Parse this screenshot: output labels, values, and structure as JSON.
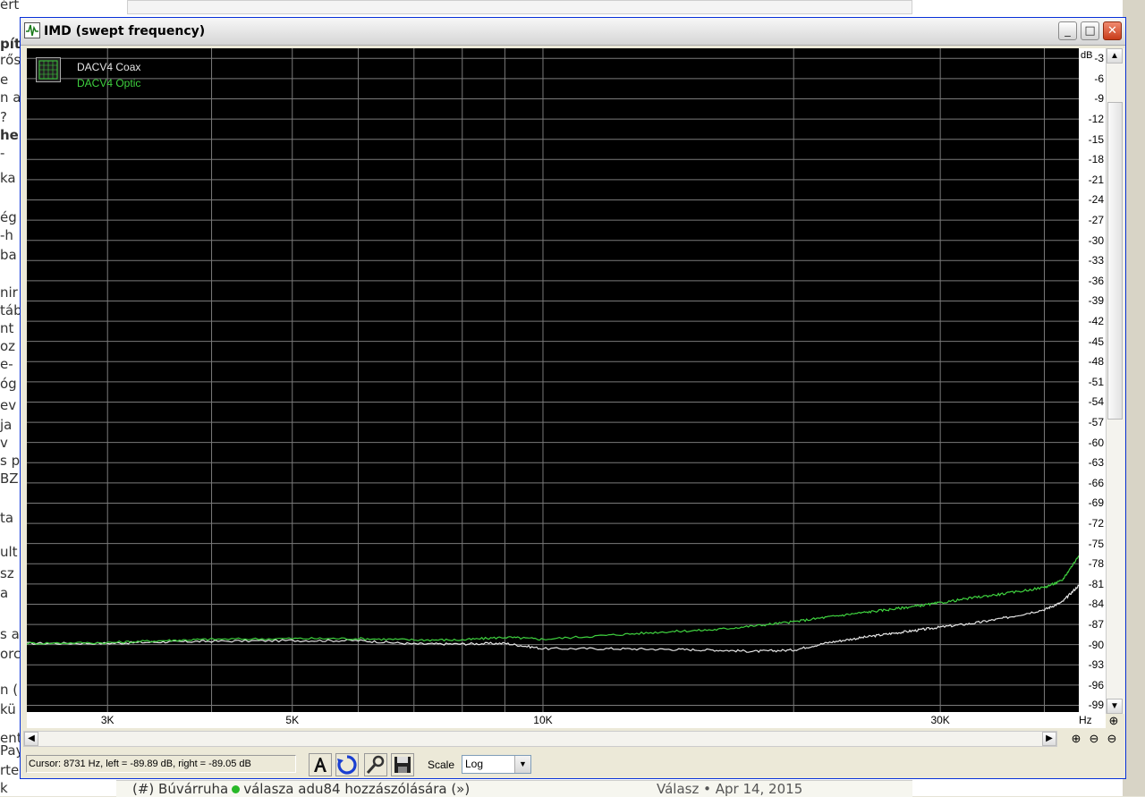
{
  "background_page": {
    "fragments": [
      {
        "text": "értek hogyanok",
        "bold": false
      },
      {
        "text": "pít",
        "bold": true
      },
      {
        "text": "rős",
        "bold": false
      },
      {
        "text": "e",
        "bold": false
      },
      {
        "text": "n al",
        "bold": false
      },
      {
        "text": "?",
        "bold": false
      },
      {
        "text": "he",
        "bold": true
      },
      {
        "text": "-",
        "bold": false
      },
      {
        "text": "ka",
        "bold": false
      },
      {
        "text": "ég",
        "bold": false
      },
      {
        "text": "-h",
        "bold": false
      },
      {
        "text": "ba",
        "bold": false
      },
      {
        "text": "nir",
        "bold": false
      },
      {
        "text": "táb",
        "bold": false
      },
      {
        "text": "nt",
        "bold": false
      },
      {
        "text": "oz",
        "bold": false
      },
      {
        "text": "e-",
        "bold": false
      },
      {
        "text": "óg",
        "bold": false
      },
      {
        "text": "ev",
        "bold": false
      },
      {
        "text": "ja",
        "bold": false
      },
      {
        "text": "v",
        "bold": false
      },
      {
        "text": "s p",
        "bold": false
      },
      {
        "text": "BZ",
        "bold": false
      },
      {
        "text": "ta",
        "bold": false
      },
      {
        "text": "ult",
        "bold": false
      },
      {
        "text": "sz",
        "bold": false
      },
      {
        "text": "a",
        "bold": false
      },
      {
        "text": "s a",
        "bold": false
      },
      {
        "text": "orc",
        "bold": false
      },
      {
        "text": "n (",
        "bold": false
      },
      {
        "text": "kü",
        "bold": false
      },
      {
        "text": "Pay",
        "bold": false
      },
      {
        "text": "rte",
        "bold": false
      },
      {
        "text": "k",
        "bold": false
      },
      {
        "text": "entes táp",
        "bold": false
      }
    ],
    "bottom_link": "(#) Búvárruha",
    "bottom_link_rest": "válasza adu84 hozzászólására (»)",
    "bottom_meta": "Válasz • Apr 14, 2015"
  },
  "window": {
    "title": "IMD (swept frequency)",
    "buttons": {
      "minimize": "_",
      "maximize": "□",
      "close": "✕"
    }
  },
  "chart_data": {
    "type": "line",
    "title": "",
    "xlabel": "Hz",
    "ylabel": "dB",
    "x_scale": "log",
    "xlim": [
      2400,
      44000
    ],
    "ylim": [
      -100,
      -1.5
    ],
    "x_ticks": [
      3000,
      5000,
      10000,
      30000
    ],
    "x_tick_labels": [
      "3K",
      "5K",
      "10K",
      "30K"
    ],
    "y_ticks": [
      -3,
      -6,
      -9,
      -12,
      -15,
      -18,
      -21,
      -24,
      -27,
      -30,
      -33,
      -36,
      -39,
      -42,
      -45,
      -48,
      -51,
      -54,
      -57,
      -60,
      -63,
      -66,
      -69,
      -72,
      -75,
      -78,
      -81,
      -84,
      -87,
      -90,
      -93,
      -96,
      -99
    ],
    "grid": true,
    "legend_position": "top-left",
    "series": [
      {
        "name": "DACV4 Coax",
        "color": "#e6e6e6",
        "x": [
          2400,
          3000,
          3500,
          4000,
          5000,
          6000,
          7000,
          8000,
          9000,
          10000,
          12000,
          14000,
          16000,
          18000,
          20000,
          22000,
          24000,
          26000,
          28000,
          30000,
          33000,
          36000,
          40000,
          42000,
          44000
        ],
        "y": [
          -89.8,
          -89.8,
          -89.6,
          -89.5,
          -89.4,
          -89.4,
          -89.9,
          -89.9,
          -89.8,
          -90.6,
          -90.6,
          -90.7,
          -90.8,
          -91.0,
          -90.8,
          -89.7,
          -89.0,
          -88.4,
          -87.9,
          -87.4,
          -86.8,
          -86.0,
          -84.8,
          -83.7,
          -81.2
        ]
      },
      {
        "name": "DACV4 Optic",
        "color": "#3fd13f",
        "x": [
          2400,
          3000,
          3500,
          4000,
          5000,
          6000,
          7000,
          8000,
          9000,
          10000,
          12000,
          14000,
          16000,
          18000,
          20000,
          22000,
          24000,
          26000,
          28000,
          30000,
          33000,
          36000,
          40000,
          42000,
          44000
        ],
        "y": [
          -89.8,
          -89.7,
          -89.4,
          -89.2,
          -89.1,
          -89.1,
          -89.3,
          -89.3,
          -88.9,
          -89.2,
          -88.6,
          -88.1,
          -87.8,
          -87.2,
          -86.6,
          -85.9,
          -85.3,
          -84.8,
          -84.3,
          -83.8,
          -83.0,
          -82.4,
          -81.5,
          -80.5,
          -76.8
        ]
      }
    ]
  },
  "toolbar": {
    "cursor_text": "Cursor:  8731 Hz,  left = -89.89 dB,  right = -89.05 dB",
    "scale_label": "Scale",
    "scale_value": "Log"
  }
}
